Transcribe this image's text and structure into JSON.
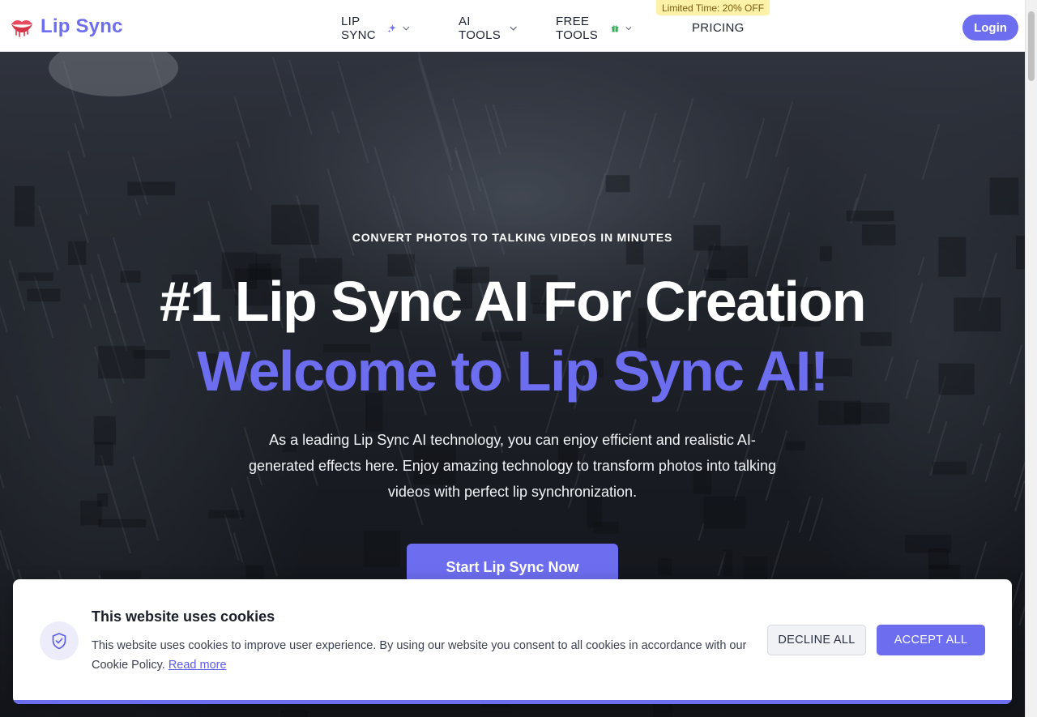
{
  "header": {
    "brand": "Lip Sync",
    "nav": {
      "lip_sync": "LIP SYNC",
      "ai_tools": "AI TOOLS",
      "free_tools": "FREE TOOLS",
      "pricing": "PRICING"
    },
    "promo_badge": "Limited Time: 20% OFF",
    "login_label": "Login"
  },
  "hero": {
    "eyebrow": "CONVERT PHOTOS TO TALKING VIDEOS IN MINUTES",
    "headline": "#1 Lip Sync AI For Creation",
    "headline_accent": "Welcome to Lip Sync AI!",
    "description": "As a leading Lip Sync AI technology, you can enjoy efficient and realistic AI-generated effects here. Enjoy amazing technology to transform photos into talking videos with perfect lip synchronization.",
    "cta_label": "Start Lip Sync Now"
  },
  "cookie_banner": {
    "title": "This website uses cookies",
    "body": "This website uses cookies to improve user experience. By using our website you consent to all cookies in accordance with our Cookie Policy.",
    "read_more": "Read more",
    "decline_label": "DECLINE ALL",
    "accept_label": "ACCEPT ALL"
  },
  "icons": {
    "logo": "lips-icon",
    "lip_sync_badge": "sparkle-icon",
    "free_tools_badge": "gift-icon",
    "dropdowns": "chevron-down-icon",
    "cookie": "shield-check-icon"
  },
  "colors": {
    "accent": "#6d6df0",
    "promo_bg": "#fdf2a8",
    "gift_green": "#3aa85a"
  }
}
